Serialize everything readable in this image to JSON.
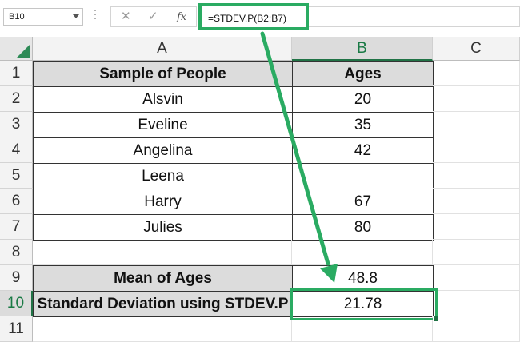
{
  "formula_bar": {
    "name_box": "B10",
    "cancel_icon": "✕",
    "enter_icon": "✓",
    "fx_label": "fx",
    "formula": "=STDEV.P(B2:B7)"
  },
  "columns": [
    "A",
    "B",
    "C"
  ],
  "rows": [
    "1",
    "2",
    "3",
    "4",
    "5",
    "6",
    "7",
    "8",
    "9",
    "10",
    "11"
  ],
  "table": {
    "header": {
      "a": "Sample of People",
      "b": "Ages"
    },
    "data": [
      {
        "name": "Alsvin",
        "age": "20"
      },
      {
        "name": "Eveline",
        "age": "35"
      },
      {
        "name": "Angelina",
        "age": "42"
      },
      {
        "name": "Leena",
        "age": ""
      },
      {
        "name": "Harry",
        "age": "67"
      },
      {
        "name": "Julies",
        "age": "80"
      }
    ],
    "summary": [
      {
        "label": "Mean of Ages",
        "value": "48.8"
      },
      {
        "label": "Standard Deviation using STDEV.P",
        "value": "21.78"
      }
    ]
  },
  "colors": {
    "accent_green": "#2aab62",
    "excel_green": "#217346",
    "header_gray": "#dcdcdc"
  }
}
